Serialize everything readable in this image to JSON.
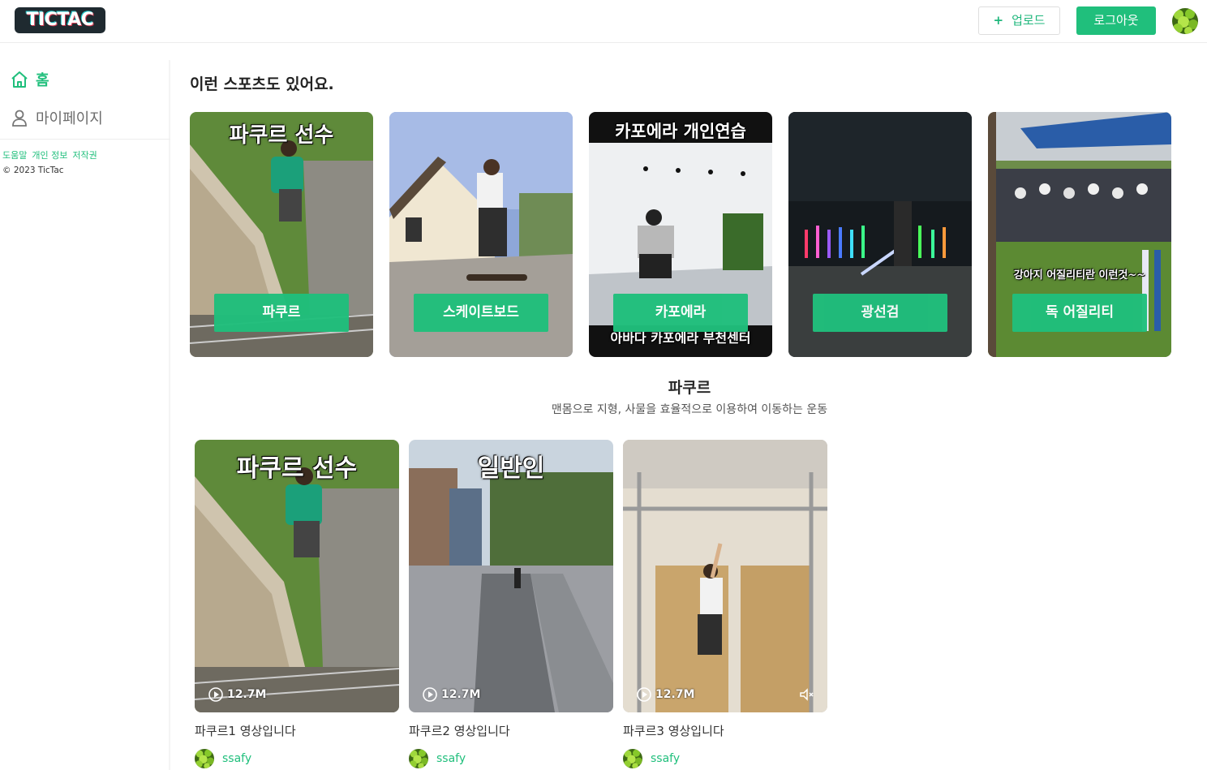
{
  "header": {
    "logo": "TICTAC",
    "upload_label": "업로드",
    "logout_label": "로그아웃"
  },
  "sidebar": {
    "items": [
      {
        "label": "홈",
        "icon": "home-icon"
      },
      {
        "label": "마이페이지",
        "icon": "user-icon"
      }
    ],
    "links": [
      "도움말",
      "개인 정보",
      "저작권"
    ],
    "copyright": "© 2023 TicTac"
  },
  "main": {
    "section_title": "이런 스포츠도 있어요.",
    "sports": [
      {
        "label": "파쿠르",
        "overlay_top": "파쿠르 선수"
      },
      {
        "label": "스케이트보드"
      },
      {
        "label": "카포에라",
        "overlay_top": "카포에라 개인연습",
        "overlay_bottom": "아바다 카포에라 부천센터"
      },
      {
        "label": "광선검"
      },
      {
        "label": "독 어질리티",
        "overlay_mid": "강아지 어질리티란 이런것~~"
      }
    ],
    "selected_sport": {
      "name": "파쿠르",
      "description": "맨몸으로 지형, 사물을 효율적으로 이용하여 이동하는 운동"
    },
    "videos": [
      {
        "overlay": "파쿠르 선수",
        "views": "12.7M",
        "title": "파쿠르1 영상입니다",
        "uploader": "ssafy"
      },
      {
        "overlay": "일반인",
        "views": "12.7M",
        "title": "파쿠르2 영상입니다",
        "uploader": "ssafy"
      },
      {
        "overlay": "",
        "views": "12.7M",
        "title": "파쿠르3 영상입니다",
        "uploader": "ssafy"
      }
    ]
  },
  "colors": {
    "accent": "#20bf7c",
    "logo_bg": "#1f2a30"
  }
}
